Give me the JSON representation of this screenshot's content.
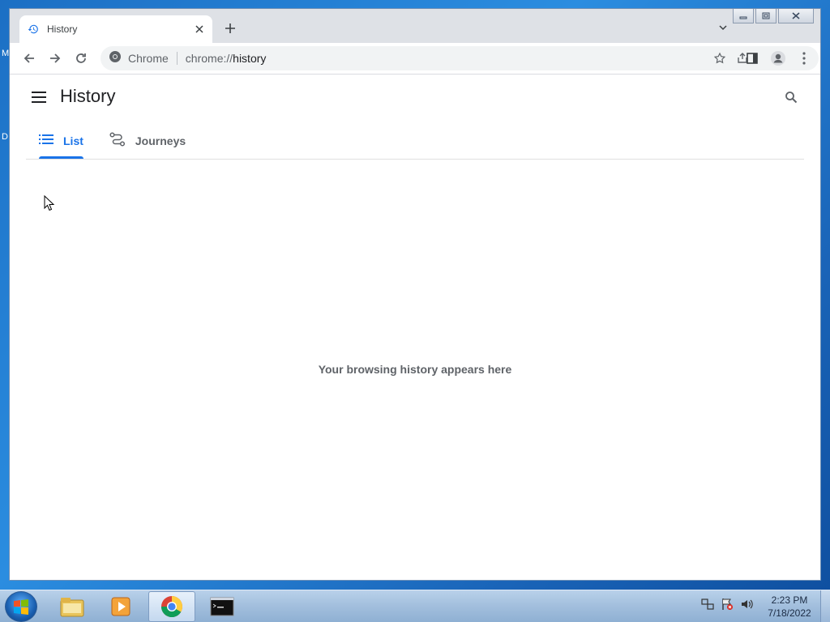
{
  "desktop": {
    "letters": [
      "M",
      "D"
    ]
  },
  "browser": {
    "tab": {
      "title": "History"
    },
    "omnibox": {
      "chip_label": "Chrome",
      "url_scheme": "chrome://",
      "url_host": "history"
    }
  },
  "page": {
    "title": "History",
    "tabs": [
      {
        "label": "List",
        "active": true
      },
      {
        "label": "Journeys",
        "active": false
      }
    ],
    "empty_message": "Your browsing history appears here"
  },
  "taskbar": {
    "time": "2:23 PM",
    "date": "7/18/2022"
  },
  "colors": {
    "accent": "#1a73e8",
    "text_secondary": "#5f6368"
  }
}
